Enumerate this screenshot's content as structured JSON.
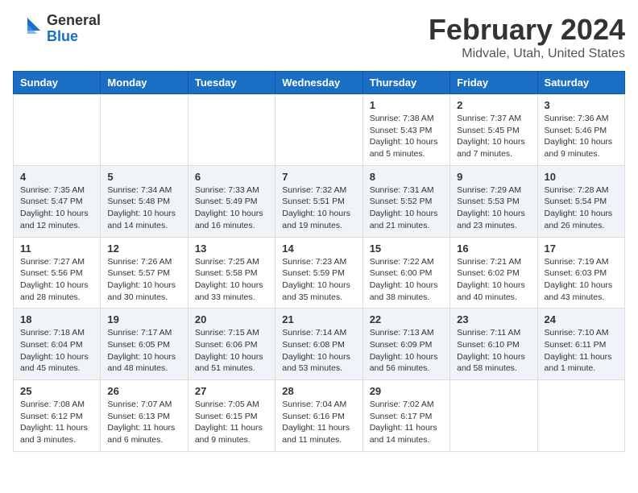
{
  "header": {
    "logo_general": "General",
    "logo_blue": "Blue",
    "title": "February 2024",
    "subtitle": "Midvale, Utah, United States"
  },
  "calendar": {
    "days_of_week": [
      "Sunday",
      "Monday",
      "Tuesday",
      "Wednesday",
      "Thursday",
      "Friday",
      "Saturday"
    ],
    "weeks": [
      [
        {
          "day": "",
          "info": ""
        },
        {
          "day": "",
          "info": ""
        },
        {
          "day": "",
          "info": ""
        },
        {
          "day": "",
          "info": ""
        },
        {
          "day": "1",
          "info": "Sunrise: 7:38 AM\nSunset: 5:43 PM\nDaylight: 10 hours\nand 5 minutes."
        },
        {
          "day": "2",
          "info": "Sunrise: 7:37 AM\nSunset: 5:45 PM\nDaylight: 10 hours\nand 7 minutes."
        },
        {
          "day": "3",
          "info": "Sunrise: 7:36 AM\nSunset: 5:46 PM\nDaylight: 10 hours\nand 9 minutes."
        }
      ],
      [
        {
          "day": "4",
          "info": "Sunrise: 7:35 AM\nSunset: 5:47 PM\nDaylight: 10 hours\nand 12 minutes."
        },
        {
          "day": "5",
          "info": "Sunrise: 7:34 AM\nSunset: 5:48 PM\nDaylight: 10 hours\nand 14 minutes."
        },
        {
          "day": "6",
          "info": "Sunrise: 7:33 AM\nSunset: 5:49 PM\nDaylight: 10 hours\nand 16 minutes."
        },
        {
          "day": "7",
          "info": "Sunrise: 7:32 AM\nSunset: 5:51 PM\nDaylight: 10 hours\nand 19 minutes."
        },
        {
          "day": "8",
          "info": "Sunrise: 7:31 AM\nSunset: 5:52 PM\nDaylight: 10 hours\nand 21 minutes."
        },
        {
          "day": "9",
          "info": "Sunrise: 7:29 AM\nSunset: 5:53 PM\nDaylight: 10 hours\nand 23 minutes."
        },
        {
          "day": "10",
          "info": "Sunrise: 7:28 AM\nSunset: 5:54 PM\nDaylight: 10 hours\nand 26 minutes."
        }
      ],
      [
        {
          "day": "11",
          "info": "Sunrise: 7:27 AM\nSunset: 5:56 PM\nDaylight: 10 hours\nand 28 minutes."
        },
        {
          "day": "12",
          "info": "Sunrise: 7:26 AM\nSunset: 5:57 PM\nDaylight: 10 hours\nand 30 minutes."
        },
        {
          "day": "13",
          "info": "Sunrise: 7:25 AM\nSunset: 5:58 PM\nDaylight: 10 hours\nand 33 minutes."
        },
        {
          "day": "14",
          "info": "Sunrise: 7:23 AM\nSunset: 5:59 PM\nDaylight: 10 hours\nand 35 minutes."
        },
        {
          "day": "15",
          "info": "Sunrise: 7:22 AM\nSunset: 6:00 PM\nDaylight: 10 hours\nand 38 minutes."
        },
        {
          "day": "16",
          "info": "Sunrise: 7:21 AM\nSunset: 6:02 PM\nDaylight: 10 hours\nand 40 minutes."
        },
        {
          "day": "17",
          "info": "Sunrise: 7:19 AM\nSunset: 6:03 PM\nDaylight: 10 hours\nand 43 minutes."
        }
      ],
      [
        {
          "day": "18",
          "info": "Sunrise: 7:18 AM\nSunset: 6:04 PM\nDaylight: 10 hours\nand 45 minutes."
        },
        {
          "day": "19",
          "info": "Sunrise: 7:17 AM\nSunset: 6:05 PM\nDaylight: 10 hours\nand 48 minutes."
        },
        {
          "day": "20",
          "info": "Sunrise: 7:15 AM\nSunset: 6:06 PM\nDaylight: 10 hours\nand 51 minutes."
        },
        {
          "day": "21",
          "info": "Sunrise: 7:14 AM\nSunset: 6:08 PM\nDaylight: 10 hours\nand 53 minutes."
        },
        {
          "day": "22",
          "info": "Sunrise: 7:13 AM\nSunset: 6:09 PM\nDaylight: 10 hours\nand 56 minutes."
        },
        {
          "day": "23",
          "info": "Sunrise: 7:11 AM\nSunset: 6:10 PM\nDaylight: 10 hours\nand 58 minutes."
        },
        {
          "day": "24",
          "info": "Sunrise: 7:10 AM\nSunset: 6:11 PM\nDaylight: 11 hours\nand 1 minute."
        }
      ],
      [
        {
          "day": "25",
          "info": "Sunrise: 7:08 AM\nSunset: 6:12 PM\nDaylight: 11 hours\nand 3 minutes."
        },
        {
          "day": "26",
          "info": "Sunrise: 7:07 AM\nSunset: 6:13 PM\nDaylight: 11 hours\nand 6 minutes."
        },
        {
          "day": "27",
          "info": "Sunrise: 7:05 AM\nSunset: 6:15 PM\nDaylight: 11 hours\nand 9 minutes."
        },
        {
          "day": "28",
          "info": "Sunrise: 7:04 AM\nSunset: 6:16 PM\nDaylight: 11 hours\nand 11 minutes."
        },
        {
          "day": "29",
          "info": "Sunrise: 7:02 AM\nSunset: 6:17 PM\nDaylight: 11 hours\nand 14 minutes."
        },
        {
          "day": "",
          "info": ""
        },
        {
          "day": "",
          "info": ""
        }
      ]
    ]
  }
}
